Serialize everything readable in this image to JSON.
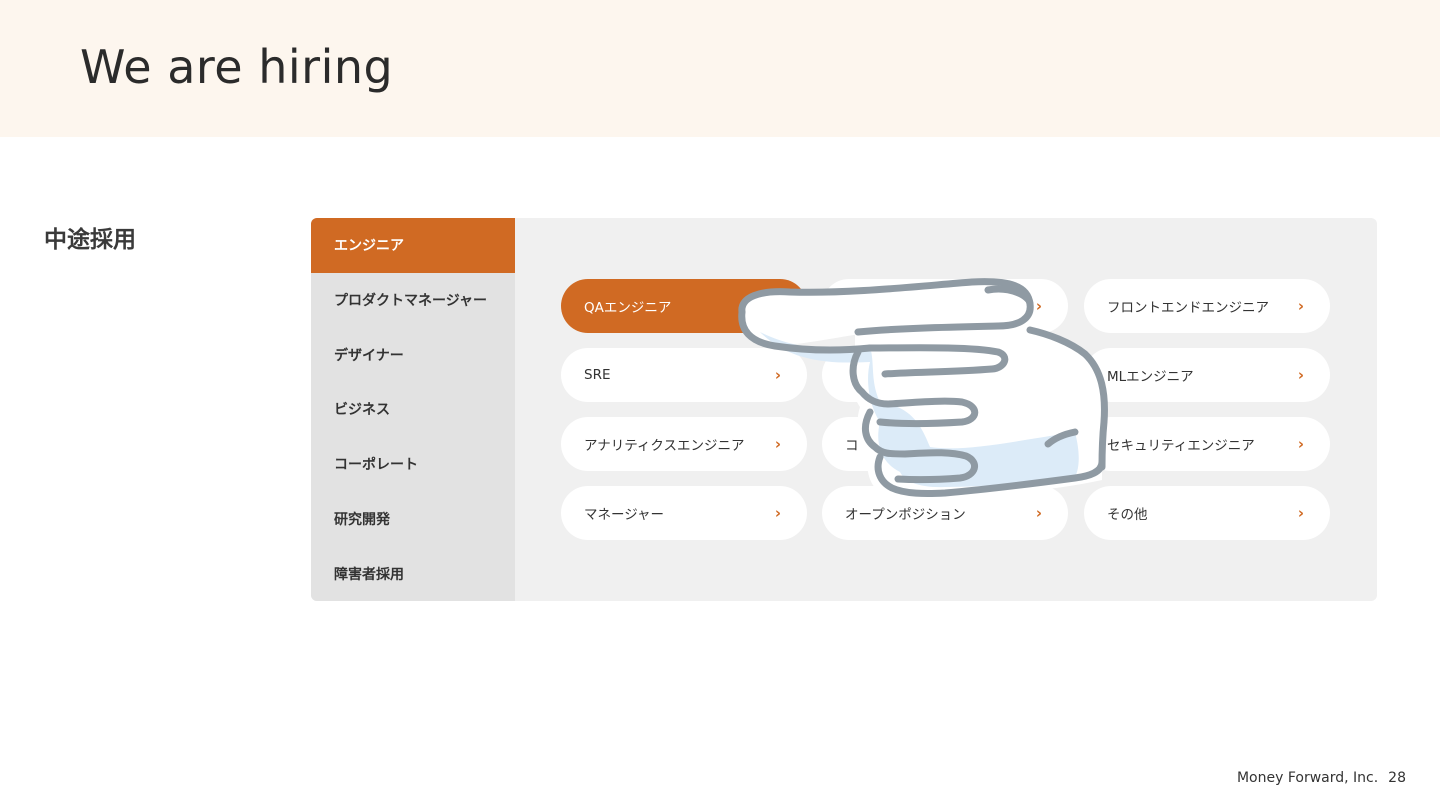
{
  "slide": {
    "title": "We are hiring",
    "section_label": "中途採用"
  },
  "sidebar": {
    "items": [
      {
        "label": "エンジニア",
        "active": true
      },
      {
        "label": "プロダクトマネージャー"
      },
      {
        "label": "デザイナー"
      },
      {
        "label": "ビジネス"
      },
      {
        "label": "コーポレート"
      },
      {
        "label": "研究開発"
      },
      {
        "label": "障害者採用"
      }
    ]
  },
  "jobs": [
    {
      "label": "QAエンジニア",
      "active": true
    },
    {
      "label": ""
    },
    {
      "label": "フロントエンドエンジニア"
    },
    {
      "label": "SRE"
    },
    {
      "label": ""
    },
    {
      "label": "MLエンジニア"
    },
    {
      "label": "アナリティクスエンジニア"
    },
    {
      "label": "コ"
    },
    {
      "label": "セキュリティエンジニア"
    },
    {
      "label": "マネージャー"
    },
    {
      "label": "オープンポジション"
    },
    {
      "label": "その他"
    }
  ],
  "chevron": "›",
  "illustration": {
    "icon": "pointing-hand-icon"
  },
  "footer": {
    "company": "Money Forward, Inc.",
    "page_number": "28"
  },
  "colors": {
    "accent": "#d06a23",
    "header_bg": "#fdf6ee",
    "panel_bg": "#f0f0f0",
    "sidebar_bg": "#e2e2e2"
  }
}
